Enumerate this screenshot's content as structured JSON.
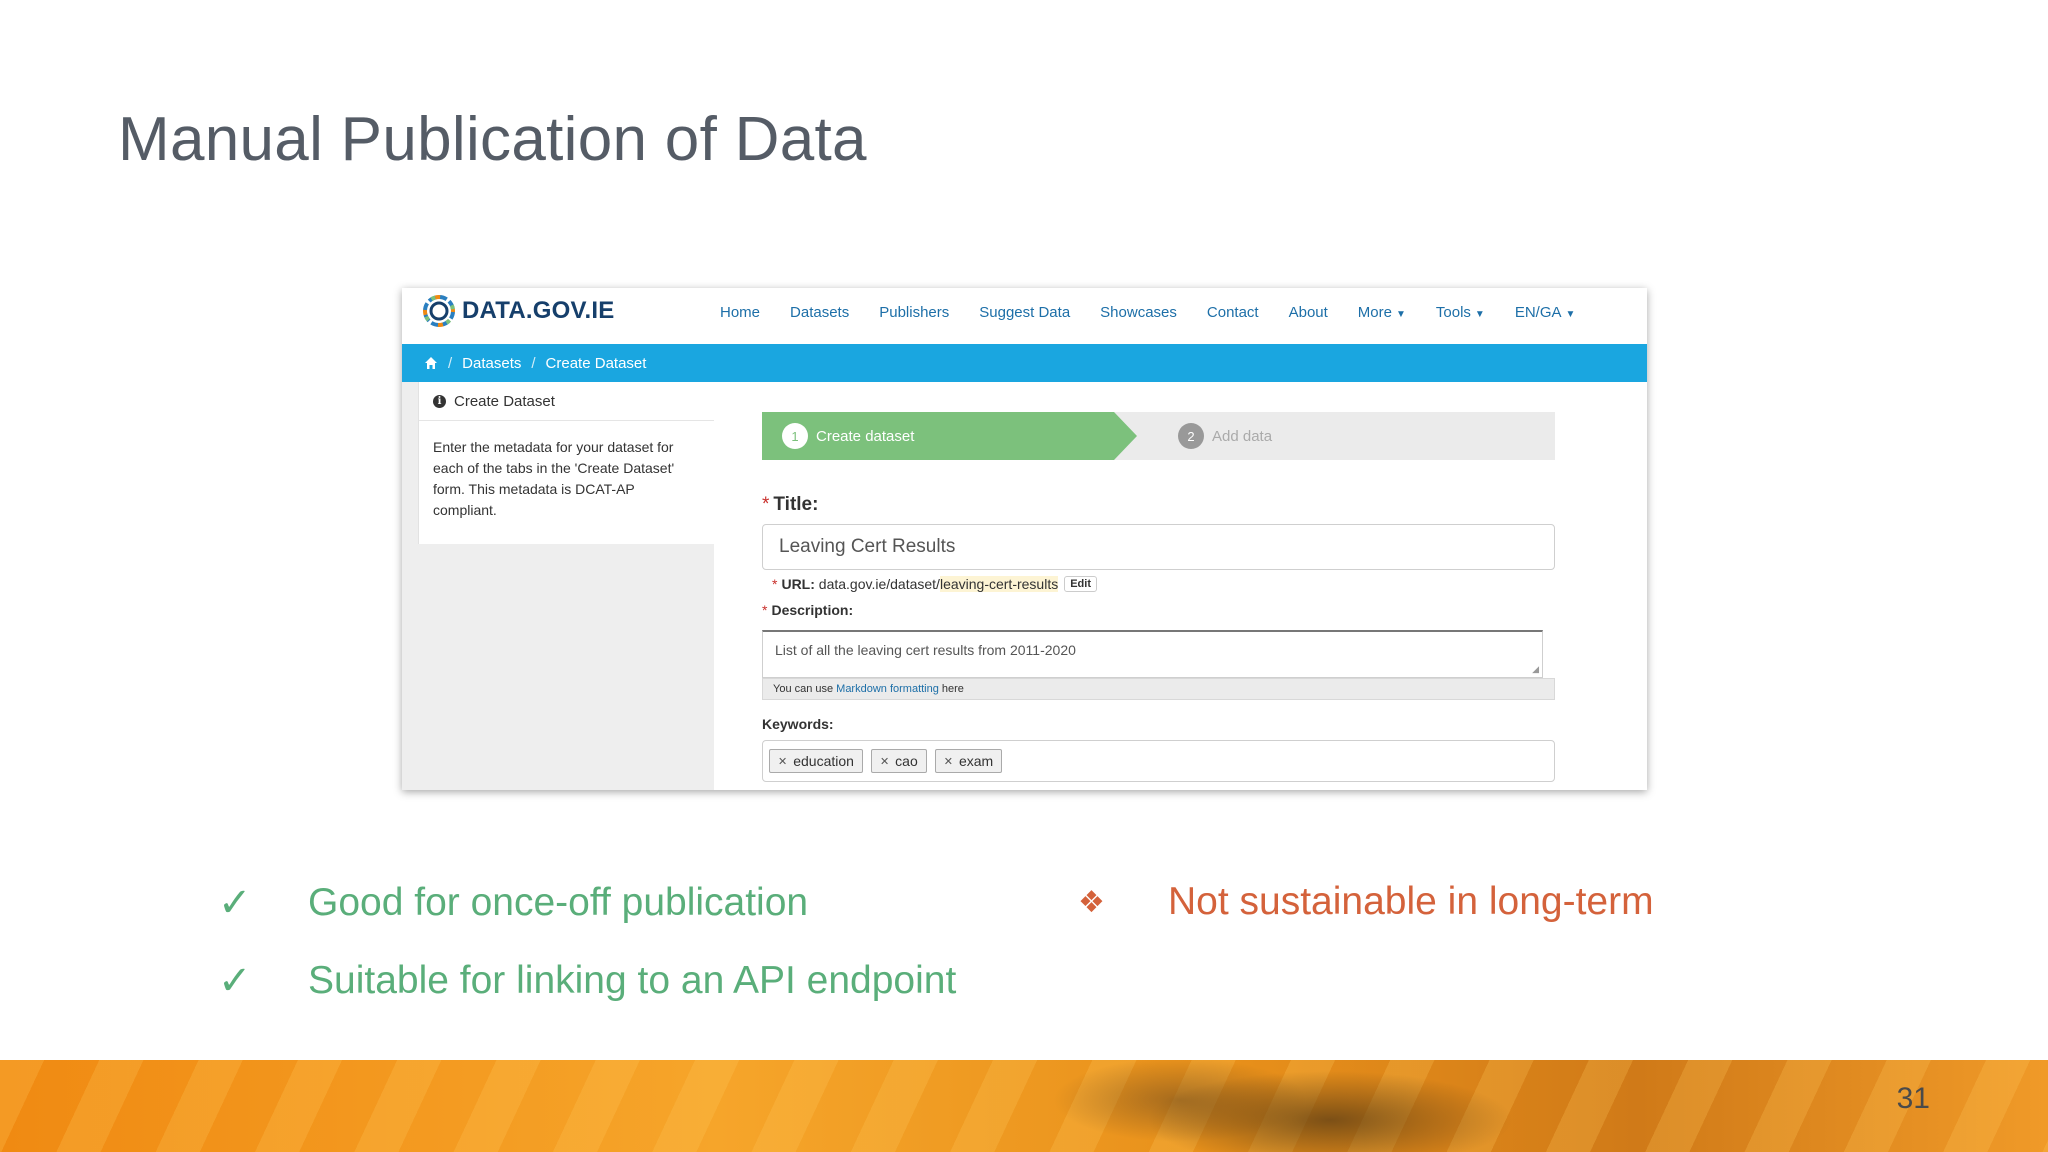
{
  "slide": {
    "title": "Manual Publication of Data",
    "page_number": "31"
  },
  "site": {
    "logo_text": "DATA.GOV.IE",
    "nav": [
      {
        "label": "Home"
      },
      {
        "label": "Datasets"
      },
      {
        "label": "Publishers"
      },
      {
        "label": "Suggest Data"
      },
      {
        "label": "Showcases"
      },
      {
        "label": "Contact"
      },
      {
        "label": "About"
      },
      {
        "label": "More",
        "dropdown": true
      },
      {
        "label": "Tools",
        "dropdown": true
      },
      {
        "label": "EN/GA",
        "dropdown": true
      }
    ],
    "breadcrumb": [
      "Datasets",
      "Create Dataset"
    ],
    "sidebar": {
      "heading": "Create Dataset",
      "body": "Enter the metadata for your dataset for each of the tabs in the 'Create Dataset' form. This metadata is DCAT-AP compliant."
    },
    "stages": [
      {
        "number": "1",
        "label": "Create dataset",
        "active": true
      },
      {
        "number": "2",
        "label": "Add data",
        "active": false
      }
    ],
    "form": {
      "title_label": "Title:",
      "title_value": "Leaving Cert Results",
      "url_label": "URL:",
      "url_prefix": "data.gov.ie/dataset/",
      "url_slug": "leaving-cert-results",
      "edit_label": "Edit",
      "description_label": "Description:",
      "description_value": "List of all the leaving cert results from 2011-2020",
      "markdown_note_pre": "You can use",
      "markdown_link": "Markdown formatting",
      "markdown_note_post": "here",
      "keywords_label": "Keywords:",
      "keywords": [
        "education",
        "cao",
        "exam"
      ]
    }
  },
  "bullets": {
    "pros": [
      "Good for once-off publication",
      "Suitable for linking to an API endpoint"
    ],
    "cons": [
      "Not sustainable in long-term"
    ]
  },
  "colors": {
    "pro": "#5aae7a",
    "con": "#d4623b",
    "breadcrumb_bar": "#1aa6e0",
    "stage_active": "#7cc17c"
  }
}
